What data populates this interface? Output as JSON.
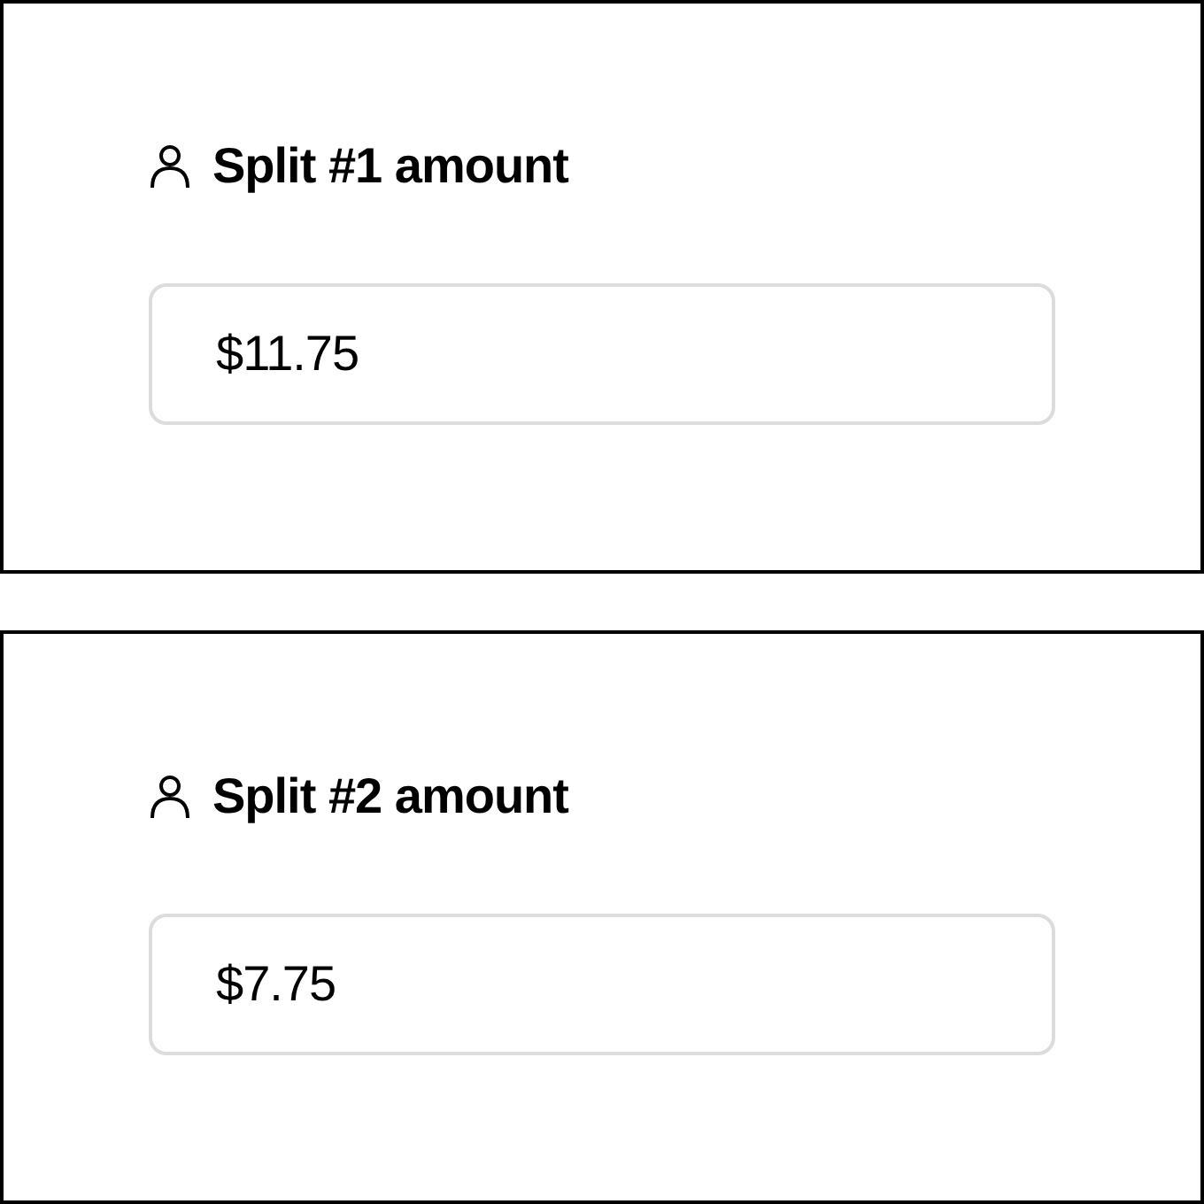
{
  "splits": [
    {
      "label": "Split #1 amount",
      "value": "$11.75"
    },
    {
      "label": "Split #2 amount",
      "value": "$7.75"
    }
  ]
}
